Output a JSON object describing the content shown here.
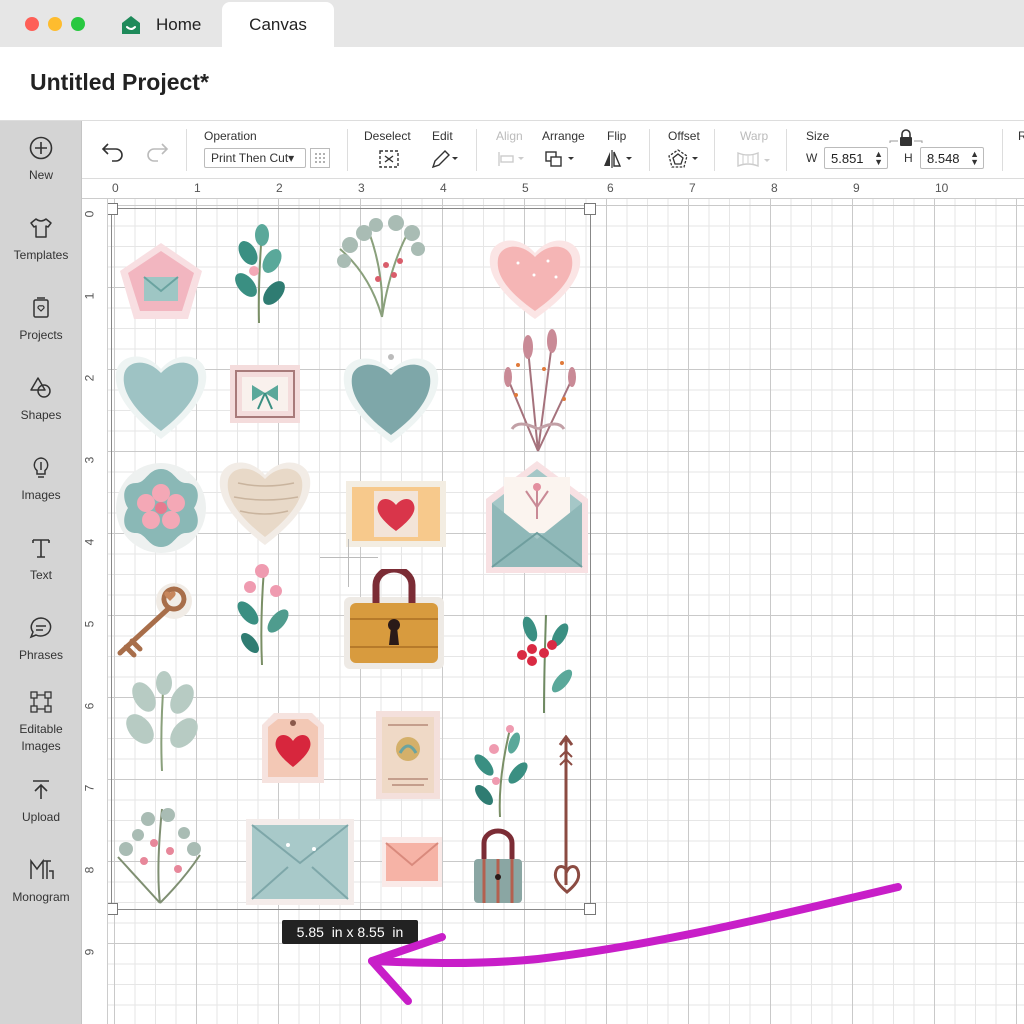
{
  "window": {
    "tabs": [
      {
        "label": "Home",
        "icon": "home-icon"
      },
      {
        "label": "Canvas",
        "active": true
      }
    ]
  },
  "project": {
    "title": "Untitled Project*"
  },
  "sidebar": {
    "items": [
      {
        "label": "New",
        "icon": "plus-circle-icon"
      },
      {
        "label": "Templates",
        "icon": "tshirt-icon"
      },
      {
        "label": "Projects",
        "icon": "projects-icon"
      },
      {
        "label": "Shapes",
        "icon": "shapes-icon"
      },
      {
        "label": "Images",
        "icon": "lightbulb-icon"
      },
      {
        "label": "Text",
        "icon": "text-icon"
      },
      {
        "label": "Phrases",
        "icon": "speech-bubble-icon"
      },
      {
        "label": "Editable Images",
        "icon": "editable-images-icon"
      },
      {
        "label": "Upload",
        "icon": "upload-icon"
      },
      {
        "label": "Monogram",
        "icon": "monogram-icon"
      }
    ]
  },
  "toolbar": {
    "operation_label": "Operation",
    "operation_value": "Print Then Cut",
    "deselect_label": "Deselect",
    "edit_label": "Edit",
    "align_label": "Align",
    "arrange_label": "Arrange",
    "flip_label": "Flip",
    "offset_label": "Offset",
    "warp_label": "Warp",
    "size_label": "Size",
    "width_letter": "W",
    "height_letter": "H",
    "width_value": "5.851",
    "height_value": "8.548",
    "next_label": "R"
  },
  "rulers": {
    "top": [
      "0",
      "1",
      "2",
      "3",
      "4",
      "5",
      "6",
      "7",
      "8",
      "9",
      "10"
    ],
    "left": [
      "0",
      "1",
      "2",
      "3",
      "4",
      "5",
      "6",
      "7",
      "8",
      "9"
    ]
  },
  "canvas": {
    "dimension_tooltip": "5.85  in x 8.55  in",
    "stickers": [
      {
        "name": "pentagon-envelope-sticker"
      },
      {
        "name": "leaf-sprig-sticker"
      },
      {
        "name": "eucalyptus-bouquet-sticker"
      },
      {
        "name": "pink-heart-sticker"
      },
      {
        "name": "blue-heart-sticker"
      },
      {
        "name": "bow-frame-sticker"
      },
      {
        "name": "blue-heart-tag-sticker"
      },
      {
        "name": "dried-flowers-sticker"
      },
      {
        "name": "flower-badge-sticker"
      },
      {
        "name": "wood-heart-sticker"
      },
      {
        "name": "heart-card-sticker"
      },
      {
        "name": "open-envelope-sticker"
      },
      {
        "name": "vintage-key-sticker"
      },
      {
        "name": "pink-leaf-sprig-sticker"
      },
      {
        "name": "padlock-sticker"
      },
      {
        "name": "red-berry-sticker"
      },
      {
        "name": "sage-leaves-sticker"
      },
      {
        "name": "heart-tag-sticker"
      },
      {
        "name": "vintage-stamp-sticker"
      },
      {
        "name": "teal-flower-sprig-sticker"
      },
      {
        "name": "small-arrow-sticker"
      },
      {
        "name": "blossom-branch-sticker"
      },
      {
        "name": "letter-envelope-sticker"
      },
      {
        "name": "pink-envelope-sticker"
      },
      {
        "name": "small-padlock-sticker"
      },
      {
        "name": "heart-key-sticker"
      }
    ]
  },
  "annotation": {
    "arrow_color": "#c81ec8"
  },
  "colors": {
    "sidebar_bg": "#d4d4d4",
    "accent_green": "#1e8a5a"
  }
}
